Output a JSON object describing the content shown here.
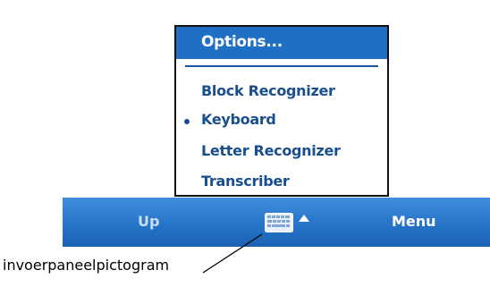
{
  "popup_menu": {
    "header": "Options...",
    "items": [
      {
        "label": "Block Recognizer",
        "selected": false
      },
      {
        "label": "Keyboard",
        "selected": true
      },
      {
        "label": "Letter Recognizer",
        "selected": false
      },
      {
        "label": "Transcriber",
        "selected": false
      }
    ]
  },
  "menubar": {
    "left_softkey": "Up",
    "right_softkey": "Menu",
    "center_icon": "keyboard-icon",
    "center_arrow": "arrow-up-icon"
  },
  "callout": {
    "label": "invoerpaneelpictogram"
  },
  "colors": {
    "accent": "#1f6fc5",
    "menu_text": "#1a4f8f",
    "bar_top": "#3f8ddb",
    "bar_bottom": "#1a62b4"
  }
}
